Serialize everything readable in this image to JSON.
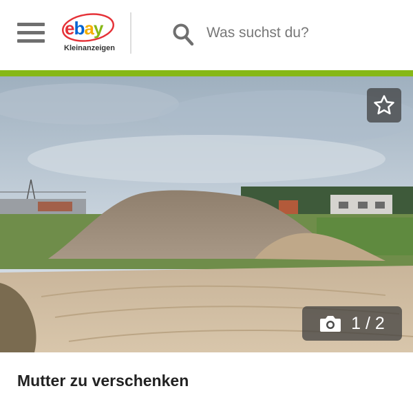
{
  "header": {
    "logo_text": "ebay",
    "logo_subtitle": "Kleinanzeigen",
    "menu_icon": "hamburger-menu-icon",
    "search": {
      "icon": "search-icon",
      "placeholder": "Was suchst du?"
    }
  },
  "colors": {
    "accent_green": "#86b817",
    "overlay": "#3c3c3c",
    "text": "#222222"
  },
  "gallery": {
    "favorite_icon": "star-icon",
    "camera_icon": "camera-icon",
    "counter": "1 / 2"
  },
  "listing": {
    "title": "Mutter zu verschenken"
  }
}
